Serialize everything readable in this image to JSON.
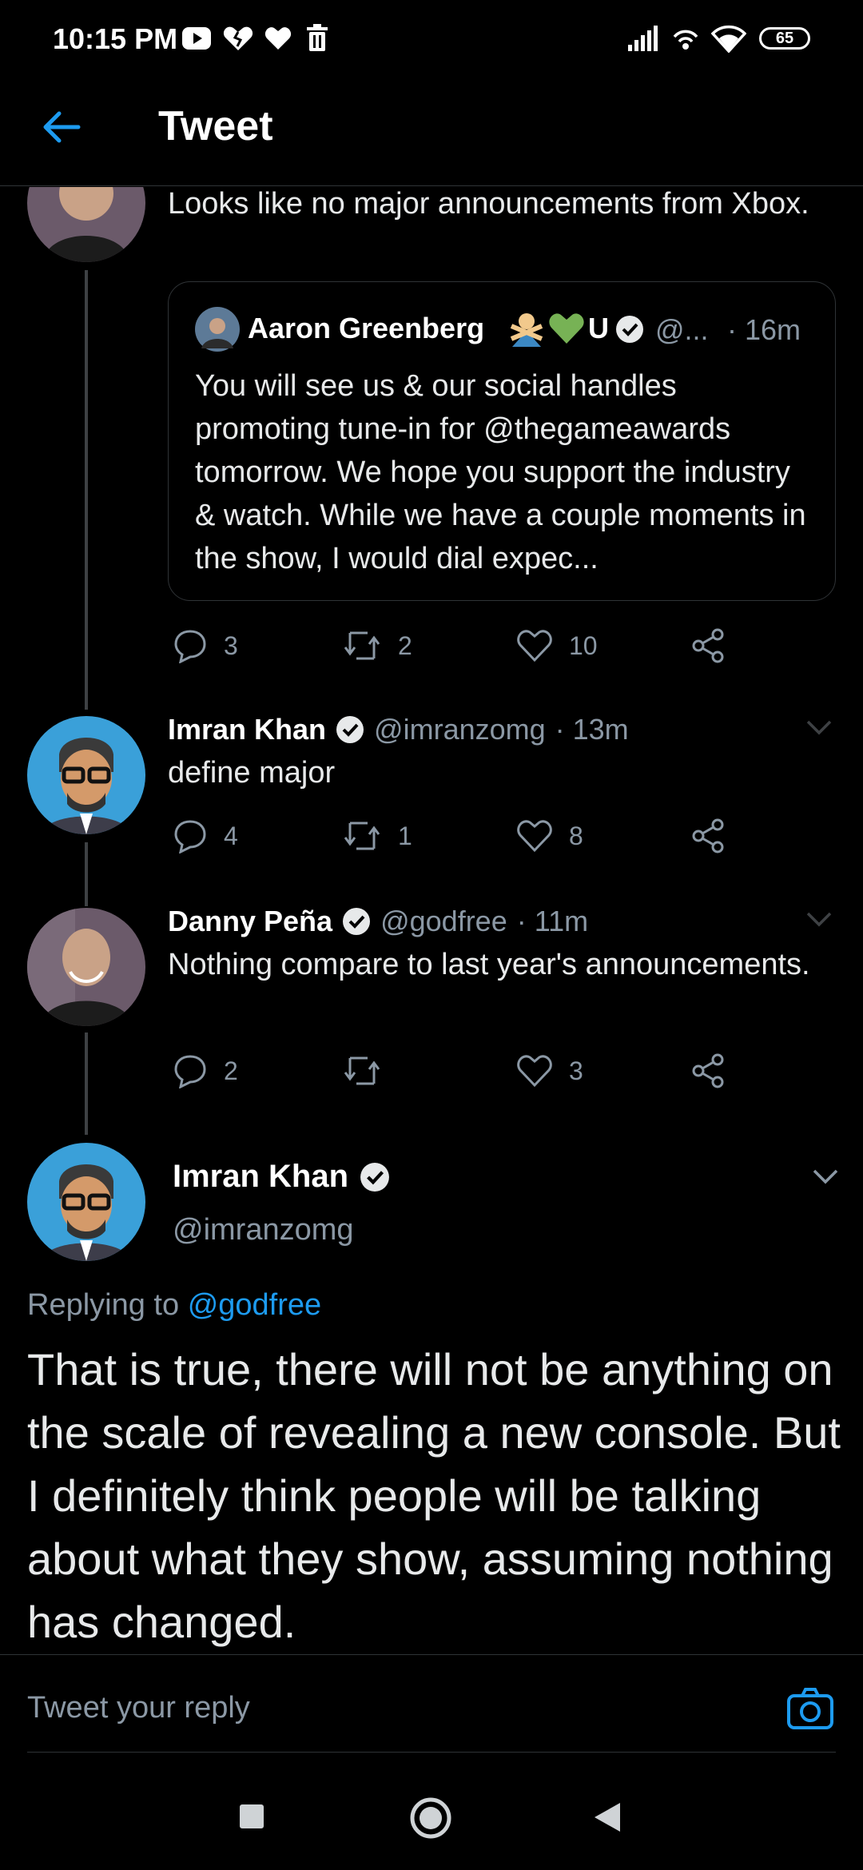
{
  "status_bar": {
    "time": "10:15 PM",
    "battery": "65",
    "icons": [
      "youtube-icon",
      "heart-broken-icon",
      "heart-icon",
      "trash-icon",
      "signal-icon",
      "hotspot-icon",
      "wifi-icon"
    ]
  },
  "header": {
    "title": "Tweet"
  },
  "thread": {
    "top_tweet_text": "Looks like no major announcements from Xbox.",
    "quote": {
      "name": "Aaron Greenberg",
      "emoji_suffix": "U",
      "handle": "@...",
      "time": "· 16m",
      "text": "You will see us & our social handles promoting tune-in for @thegameawards tomorrow. We hope you support the industry & watch. While we have a couple moments in the show, I would dial expec..."
    },
    "top_actions": {
      "replies": "3",
      "retweets": "2",
      "likes": "10"
    },
    "reply1": {
      "name": "Imran Khan",
      "handle": "@imranzomg",
      "time": "· 13m",
      "text": "define major",
      "replies": "4",
      "retweets": "1",
      "likes": "8"
    },
    "reply2": {
      "name": "Danny Peña",
      "handle": "@godfree",
      "time": "· 11m",
      "text": "Nothing compare to last year's announcements.",
      "replies": "2",
      "retweets": "",
      "likes": "3"
    }
  },
  "main_tweet": {
    "name": "Imran Khan",
    "handle": "@imranzomg",
    "replying_prefix": "Replying to",
    "replying_handle": "@godfree",
    "text": "That is true, there will not be anything on the scale of revealing a new console. But I definitely think people will be talking about what they show, assuming nothing has changed."
  },
  "reply_bar": {
    "placeholder": "Tweet your reply"
  },
  "colors": {
    "accent": "#1d9bf0",
    "background": "#000000",
    "muted": "#8b98a5"
  }
}
